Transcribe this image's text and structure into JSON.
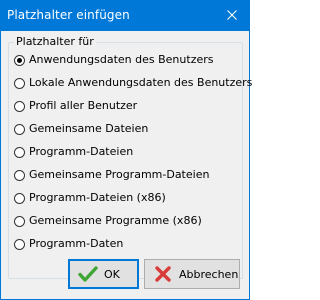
{
  "window": {
    "title": "Platzhalter einfügen",
    "close_icon": "close-icon"
  },
  "group": {
    "legend": "Platzhalter für",
    "selected_index": 0,
    "options": [
      "Anwendungsdaten des Benutzers",
      "Lokale Anwendungsdaten des Benutzers",
      "Profil aller Benutzer",
      "Gemeinsame Dateien",
      "Programm-Dateien",
      "Gemeinsame Programm-Dateien",
      "Programm-Dateien (x86)",
      "Gemeinsame Programme (x86)",
      "Programm-Daten"
    ]
  },
  "buttons": {
    "ok_label": "OK",
    "ok_icon": "checkmark-icon",
    "cancel_label": "Abbrechen",
    "cancel_icon": "cross-icon"
  },
  "colors": {
    "titlebar": "#0078d7",
    "ok_icon": "#3fa535",
    "cancel_icon": "#d93a3a"
  }
}
